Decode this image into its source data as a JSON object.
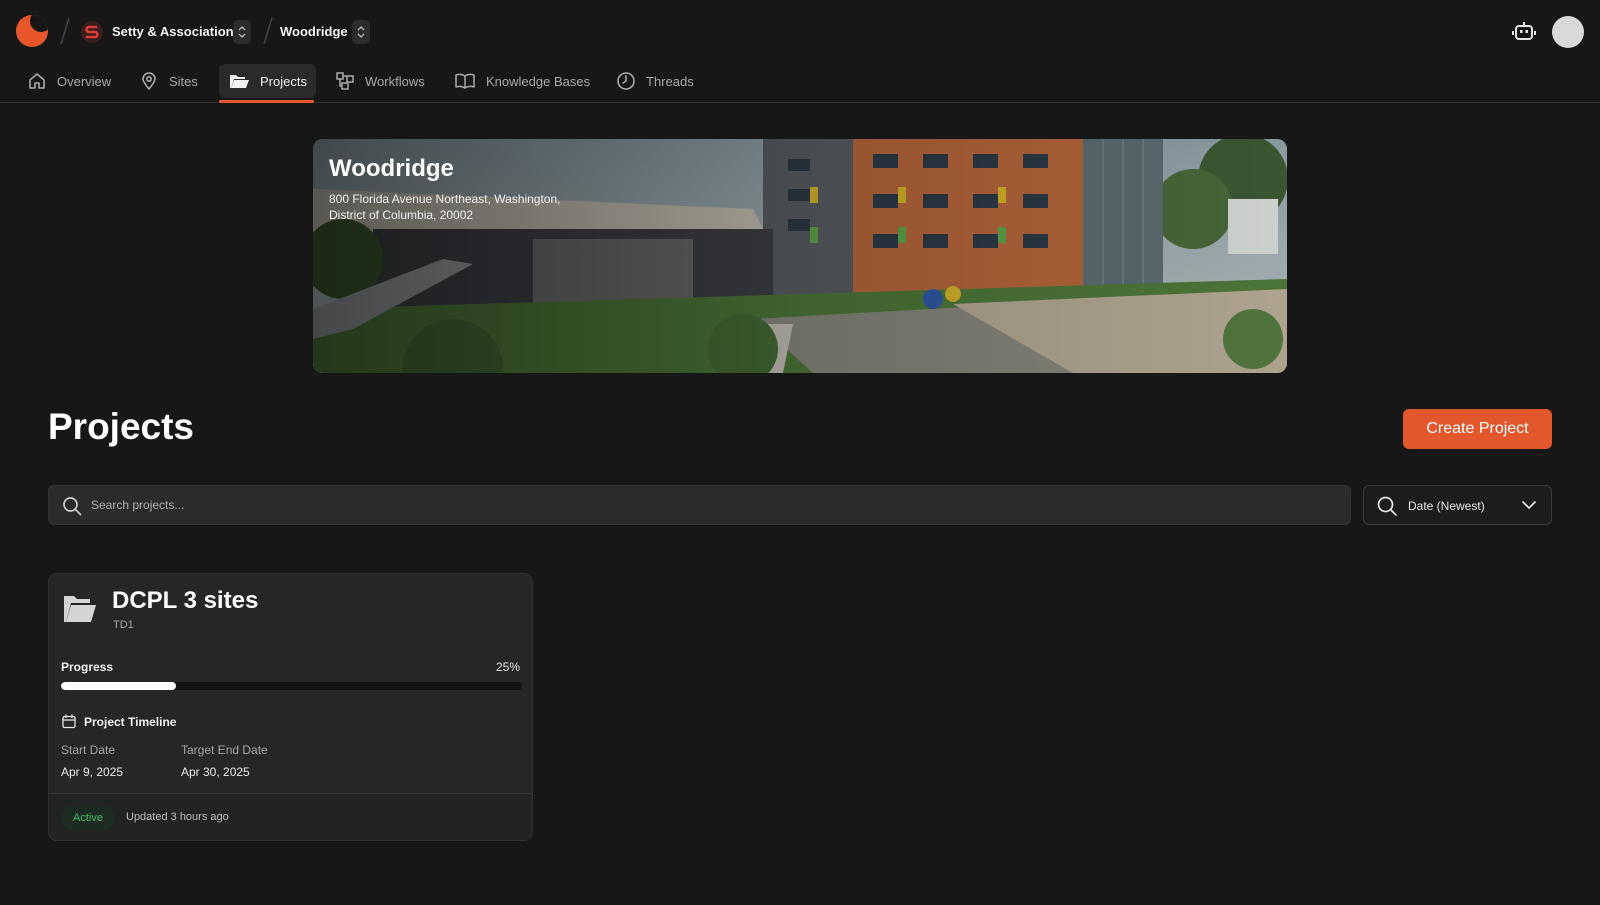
{
  "breadcrumb": {
    "org_initial": "S",
    "org_name": "Setty & Association",
    "site_name": "Woodridge"
  },
  "nav": {
    "items": [
      {
        "label": "Overview",
        "icon": "home-icon"
      },
      {
        "label": "Sites",
        "icon": "map-pin-icon"
      },
      {
        "label": "Projects",
        "icon": "folder-open-icon",
        "active": true
      },
      {
        "label": "Workflows",
        "icon": "workflow-icon"
      },
      {
        "label": "Knowledge Bases",
        "icon": "book-open-icon"
      },
      {
        "label": "Threads",
        "icon": "clock-icon"
      }
    ]
  },
  "banner": {
    "title": "Woodridge",
    "address": "800 Florida Avenue Northeast, Washington, District of Columbia, 20002"
  },
  "page": {
    "title": "Projects",
    "create_label": "Create Project"
  },
  "search": {
    "placeholder": "Search projects...",
    "value": ""
  },
  "sort": {
    "selected": "Date (Newest)"
  },
  "projects": [
    {
      "name": "DCPL 3 sites",
      "code": "TD1",
      "progress_label": "Progress",
      "progress_pct": 25,
      "progress_text": "25%",
      "timeline_label": "Project Timeline",
      "start_label": "Start Date",
      "start_date": "Apr 9, 2025",
      "end_label": "Target End Date",
      "end_date": "Apr 30, 2025",
      "status": "Active",
      "updated": "Updated 3 hours ago"
    }
  ],
  "colors": {
    "accent": "#e2572b",
    "background": "#171717",
    "card": "#262626",
    "status_active": "#3fbf62"
  }
}
